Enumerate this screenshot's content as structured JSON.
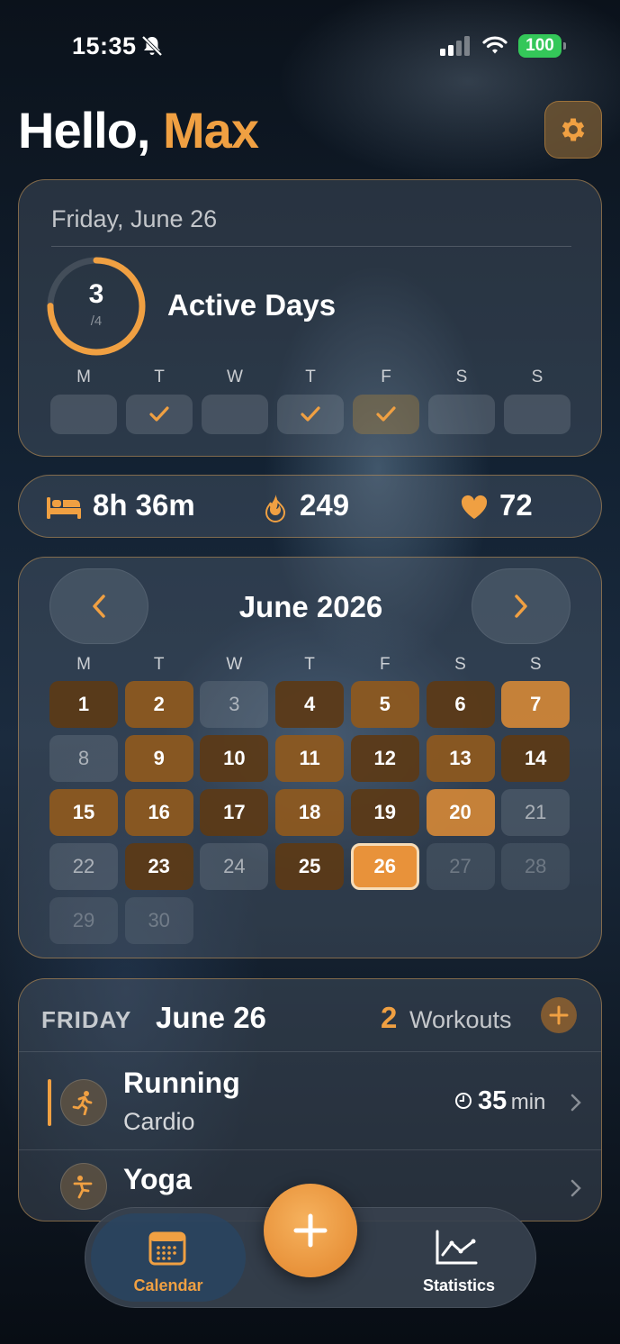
{
  "status_bar": {
    "time": "15:35",
    "battery": "100"
  },
  "header": {
    "greeting": "Hello,",
    "name": "Max"
  },
  "summary": {
    "date": "Friday, June 26",
    "active_days": "3",
    "goal": "/4",
    "goal_progress": 0.75,
    "label": "Active Days",
    "week": [
      {
        "letter": "M",
        "done": false
      },
      {
        "letter": "T",
        "done": true
      },
      {
        "letter": "W",
        "done": false
      },
      {
        "letter": "T",
        "done": true
      },
      {
        "letter": "F",
        "done": true
      },
      {
        "letter": "S",
        "done": false
      },
      {
        "letter": "S",
        "done": false
      }
    ]
  },
  "stats": {
    "sleep": "8h 36m",
    "calories": "249",
    "heart_rate": "72"
  },
  "calendar": {
    "month": "June 2026",
    "weekdays": [
      "M",
      "T",
      "W",
      "T",
      "F",
      "S",
      "S"
    ],
    "days": [
      {
        "d": "1",
        "level": 1
      },
      {
        "d": "2",
        "level": 2
      },
      {
        "d": "3",
        "level": 0
      },
      {
        "d": "4",
        "level": 1
      },
      {
        "d": "5",
        "level": 2
      },
      {
        "d": "6",
        "level": 1
      },
      {
        "d": "7",
        "level": 3
      },
      {
        "d": "8",
        "level": 0
      },
      {
        "d": "9",
        "level": 2
      },
      {
        "d": "10",
        "level": 1
      },
      {
        "d": "11",
        "level": 2
      },
      {
        "d": "12",
        "level": 1
      },
      {
        "d": "13",
        "level": 2
      },
      {
        "d": "14",
        "level": 1
      },
      {
        "d": "15",
        "level": 2
      },
      {
        "d": "16",
        "level": 2
      },
      {
        "d": "17",
        "level": 1
      },
      {
        "d": "18",
        "level": 2
      },
      {
        "d": "19",
        "level": 1
      },
      {
        "d": "20",
        "level": 3
      },
      {
        "d": "21",
        "level": 0
      },
      {
        "d": "22",
        "level": 0
      },
      {
        "d": "23",
        "level": 1
      },
      {
        "d": "24",
        "level": 0
      },
      {
        "d": "25",
        "level": 1
      },
      {
        "d": "26",
        "level": "today"
      },
      {
        "d": "27",
        "level": "future"
      },
      {
        "d": "28",
        "level": "future"
      },
      {
        "d": "29",
        "level": "future"
      },
      {
        "d": "30",
        "level": "future"
      }
    ]
  },
  "workouts": {
    "weekday": "FRIDAY",
    "date": "June 26",
    "count": "2",
    "count_label": "Workouts",
    "items": [
      {
        "name": "Running",
        "type": "Cardio",
        "duration": "35",
        "unit": "min",
        "icon": "running-icon"
      },
      {
        "name": "Yoga",
        "type": "",
        "icon": "yoga-icon"
      }
    ]
  },
  "tabbar": {
    "calendar_label": "Calendar",
    "statistics_label": "Statistics"
  },
  "colors": {
    "accent": "#f0a042",
    "battery": "#34c759"
  }
}
